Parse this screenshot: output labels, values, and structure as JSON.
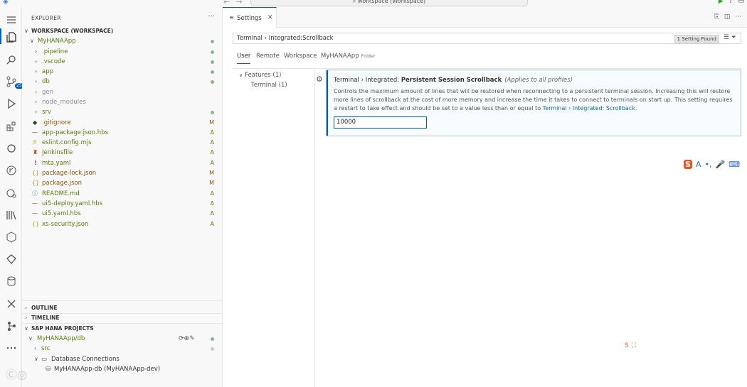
{
  "titlebar": {
    "search_label": "⌕ workspace (Workspace)"
  },
  "sidebar": {
    "header": "EXPLORER",
    "workspace_title": "WORKSPACE (WORKSPACE)",
    "project": "MyHANAApp",
    "folders": [
      {
        "name": ".pipeline",
        "dot": true
      },
      {
        "name": ".vscode",
        "dot": true
      },
      {
        "name": "app",
        "dot": true
      },
      {
        "name": "db",
        "dot": true
      },
      {
        "name": "gen",
        "dot": false
      },
      {
        "name": "node_modules",
        "dot": false
      },
      {
        "name": "srv",
        "dot": true
      }
    ],
    "files": [
      {
        "icon": "◆",
        "name": ".gitignore",
        "status": "M"
      },
      {
        "icon": "⁓",
        "name": "app-package.json.hbs",
        "status": "A"
      },
      {
        "icon": "JS",
        "name": "eslint.config.mjs",
        "status": "A"
      },
      {
        "icon": "♜",
        "name": "Jenkinsfile",
        "status": "A"
      },
      {
        "icon": "!",
        "name": "mta.yaml",
        "status": "A"
      },
      {
        "icon": "{}",
        "name": "package-lock.json",
        "status": "M"
      },
      {
        "icon": "{}",
        "name": "package.json",
        "status": "M"
      },
      {
        "icon": "ⓘ",
        "name": "README.md",
        "status": "A"
      },
      {
        "icon": "⁓",
        "name": "ui5-deploy.yaml.hbs",
        "status": "A"
      },
      {
        "icon": "⁓",
        "name": "ui5.yaml.hbs",
        "status": "A"
      },
      {
        "icon": "{}",
        "name": "xs-security.json",
        "status": "A"
      }
    ],
    "outline": "OUTLINE",
    "timeline": "TIMELINE",
    "hana_projects": "SAP HANA PROJECTS",
    "hana_db": "MyHANAApp/db",
    "hana_src": "src",
    "hana_connections": "Database Connections",
    "hana_conn_item": "MyHANAApp-db (MyHANAApp-dev)",
    "scm_badge": "25"
  },
  "editor": {
    "tab_label": "Settings",
    "search_value": "Terminal › Integrated:Scrollback",
    "search_count": "1 Setting Found",
    "scope_tabs": [
      "User",
      "Remote",
      "Workspace",
      "MyHANAApp"
    ],
    "folder_hint": "Folder",
    "toc": {
      "features": "Features (1)",
      "terminal": "Terminal (1)"
    },
    "setting": {
      "title_prefix": "Terminal › Integrated: ",
      "title_bold": "Persistent Session Scrollback",
      "scope": "(Applies to all profiles)",
      "description": "Controls the maximum amount of lines that will be restored when reconnecting to a persistent terminal session. Increasing this will restore more lines of scrollback at the cost of more memory and increase the time it takes to connect to terminals on start up. This setting requires a restart to take effect and should be set to a value less than or equal to ",
      "link": "Terminal › Integrated: Scrollback",
      "description_end": ".",
      "value": "10000"
    }
  },
  "colors": {
    "accent": "#005fb8",
    "added": "#587c0c",
    "modified": "#895503"
  }
}
